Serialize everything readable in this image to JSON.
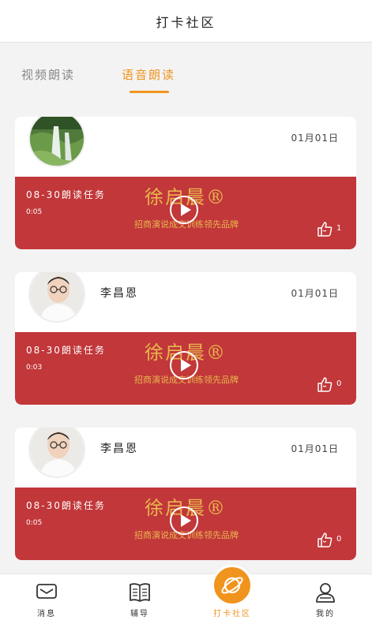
{
  "header": {
    "title": "打卡社区"
  },
  "tabs": [
    {
      "label": "视频朗读",
      "active": false
    },
    {
      "label": "语音朗读",
      "active": true
    }
  ],
  "posts": [
    {
      "name": "",
      "date": "01月01日",
      "task": "08-30朗读任务",
      "duration": "0:05",
      "brand": "徐启晨®",
      "slogan": "招商演说成交训练领先品牌",
      "likes": "1",
      "avatar": "waterfall-photo"
    },
    {
      "name": "李昌恩",
      "date": "01月01日",
      "task": "08-30朗读任务",
      "duration": "0:03",
      "brand": "徐启晨®",
      "slogan": "招商演说成交训练领先品牌",
      "likes": "0",
      "avatar": "man-with-glasses-photo"
    },
    {
      "name": "李昌恩",
      "date": "01月01日",
      "task": "08-30朗读任务",
      "duration": "0:05",
      "brand": "徐启晨®",
      "slogan": "招商演说成交训练领先品牌",
      "likes": "0",
      "avatar": "man-with-glasses-photo"
    }
  ],
  "nav": [
    {
      "label": "消息",
      "icon": "message-icon"
    },
    {
      "label": "辅导",
      "icon": "book-icon"
    },
    {
      "label": "打卡社区",
      "icon": "planet-icon",
      "active": true
    },
    {
      "label": "我的",
      "icon": "user-icon"
    }
  ],
  "colors": {
    "accent": "#f0941e",
    "player_bg": "#c1373a",
    "brand_gold": "#e9b64e"
  }
}
